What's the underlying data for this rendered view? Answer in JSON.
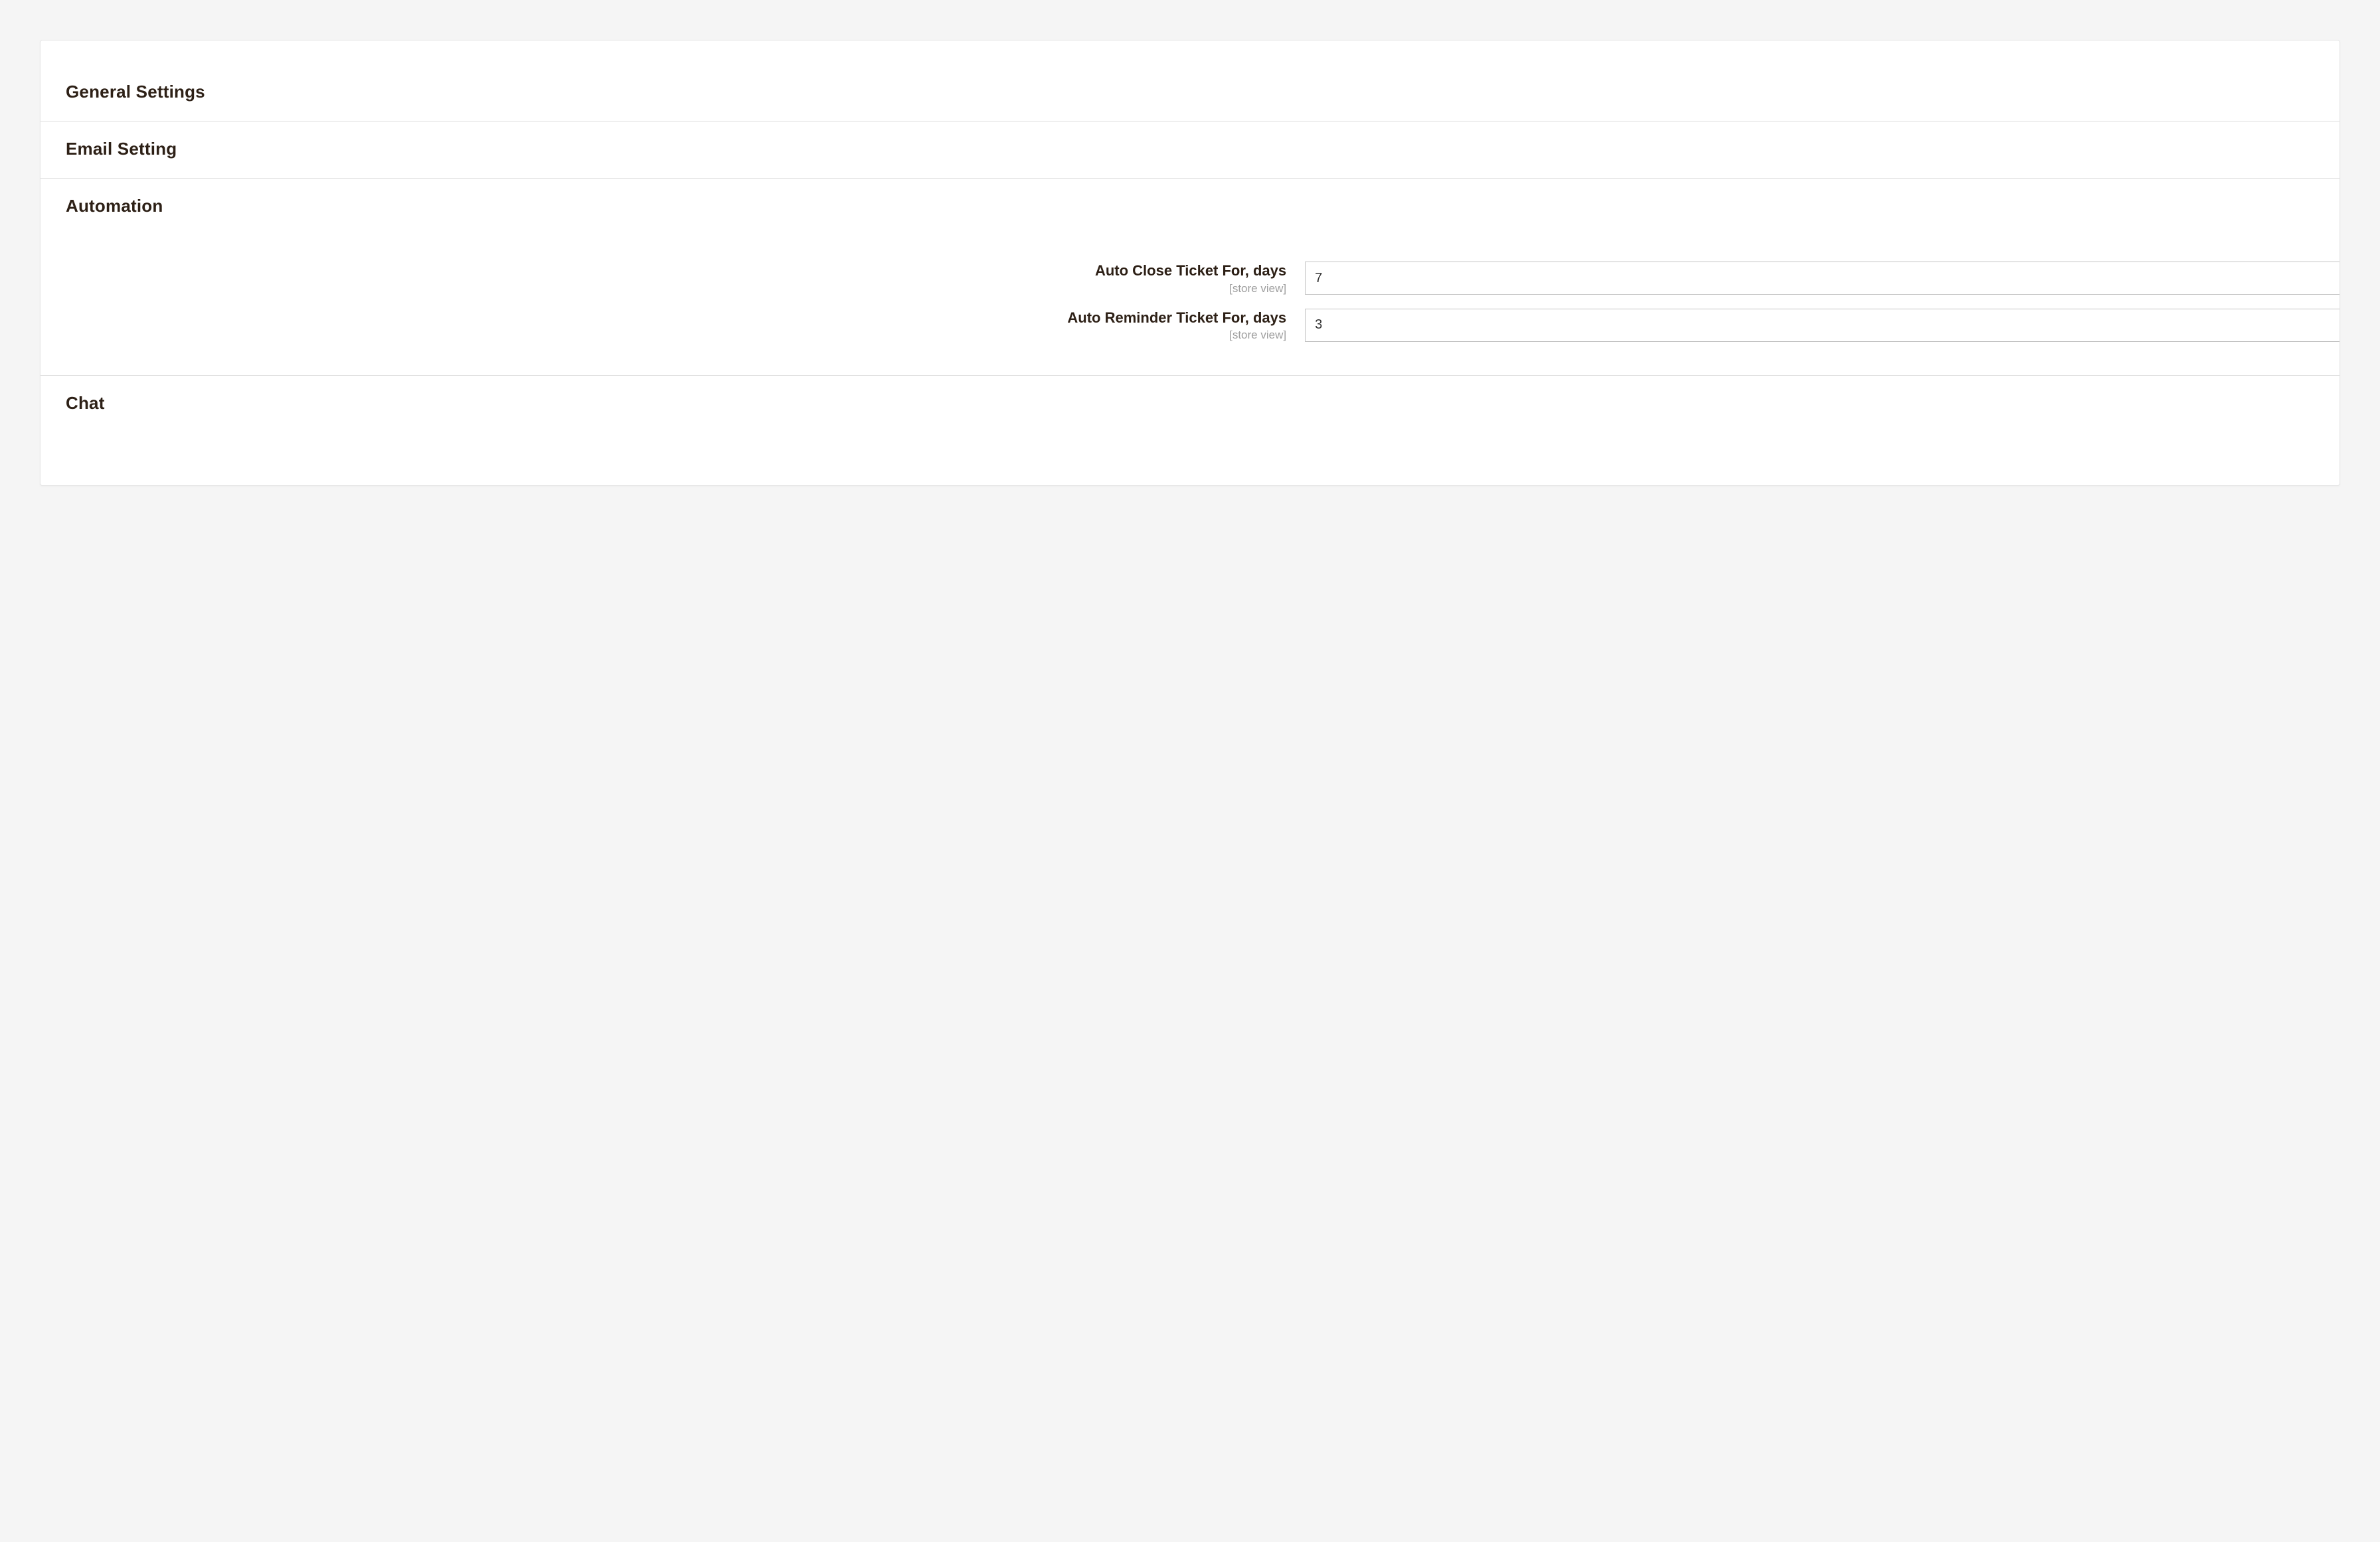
{
  "sections": {
    "general": {
      "title": "General Settings"
    },
    "email": {
      "title": "Email Setting"
    },
    "automation": {
      "title": "Automation",
      "fields": {
        "autoClose": {
          "label": "Auto Close Ticket For, days",
          "scope": "[store view]",
          "value": "7"
        },
        "autoReminder": {
          "label": "Auto Reminder Ticket For, days",
          "scope": "[store view]",
          "value": "3"
        }
      }
    },
    "chat": {
      "title": "Chat"
    }
  }
}
